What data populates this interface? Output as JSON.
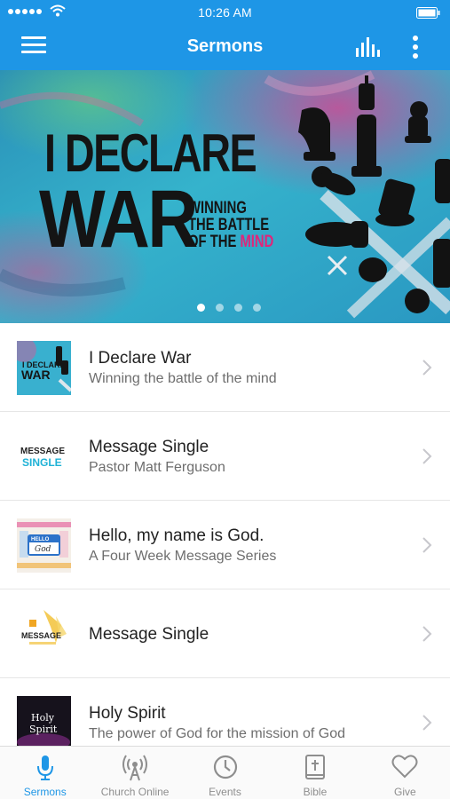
{
  "status_bar": {
    "time": "10:26 AM"
  },
  "header": {
    "title": "Sermons"
  },
  "hero": {
    "title_line1": "I DECLARE",
    "title_line2": "WAR",
    "subtitle_line1": "WINNING",
    "subtitle_line2": "THE BATTLE",
    "subtitle_line3_a": "OF THE ",
    "subtitle_line3_b": "MIND",
    "carousel_pages": 4,
    "active_page": 1
  },
  "sermons": [
    {
      "title": "I Declare War",
      "subtitle": "Winning the battle of the mind",
      "thumb_text_1": "I DECLARE",
      "thumb_text_2": "WAR"
    },
    {
      "title": "Message Single",
      "subtitle": "Pastor Matt Ferguson",
      "thumb_text_1": "MESSAGE",
      "thumb_text_2": "SINGLE"
    },
    {
      "title": "Hello, my name is God.",
      "subtitle": "A Four Week Message Series",
      "thumb_text_1": "HELLO",
      "thumb_text_2": "God"
    },
    {
      "title": "Message Single",
      "subtitle": "",
      "thumb_text_1": "MESSAGE"
    },
    {
      "title": "Holy Spirit",
      "subtitle": "The power of God for the mission of God",
      "thumb_text_1": "Holy",
      "thumb_text_2": "Spirit"
    }
  ],
  "tabs": [
    {
      "label": "Sermons",
      "icon": "microphone-icon"
    },
    {
      "label": "Church Online",
      "icon": "broadcast-icon"
    },
    {
      "label": "Events",
      "icon": "clock-icon"
    },
    {
      "label": "Bible",
      "icon": "bible-icon"
    },
    {
      "label": "Give",
      "icon": "heart-icon"
    }
  ],
  "colors": {
    "accent": "#1e96e6",
    "inactive_tab": "#8e8e8e",
    "highlight": "#e0257a"
  }
}
